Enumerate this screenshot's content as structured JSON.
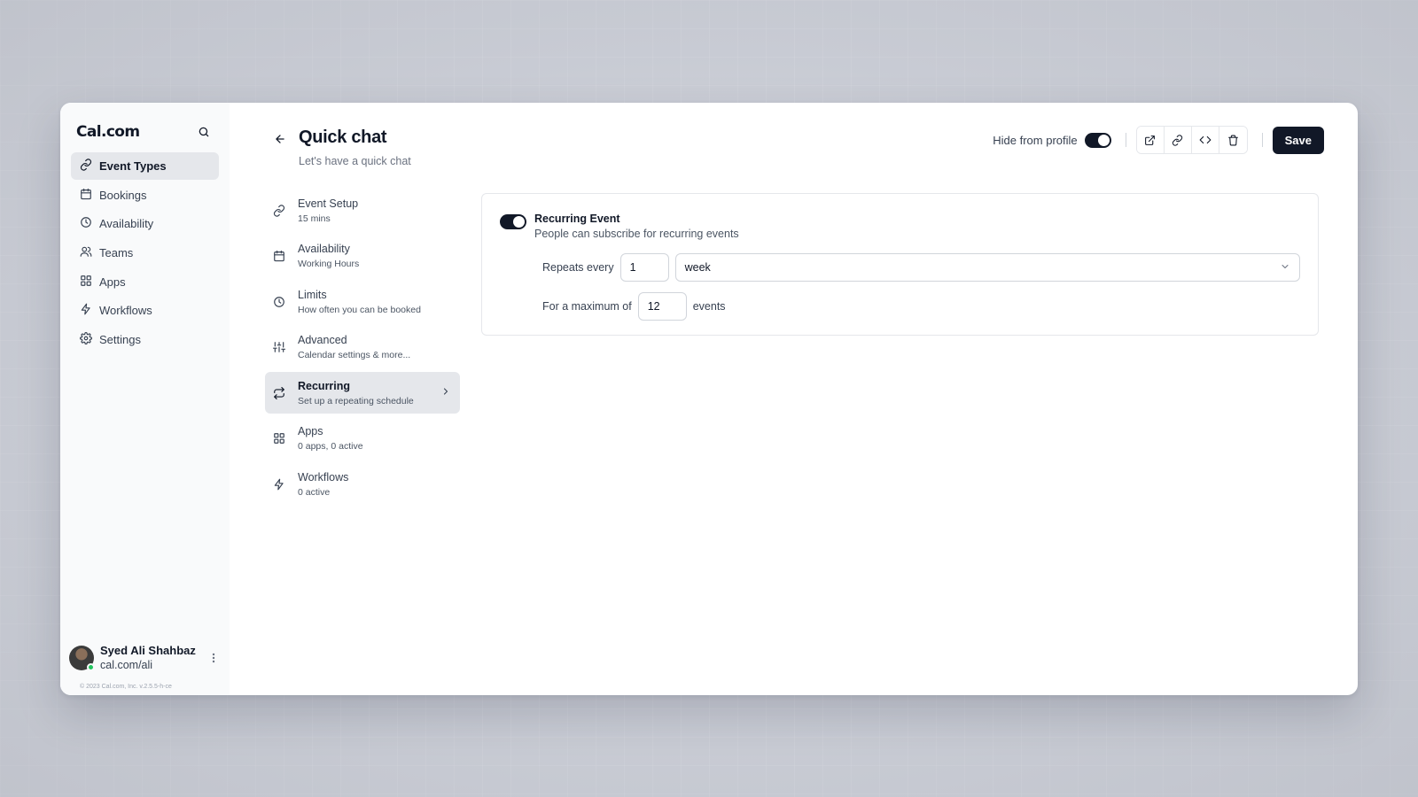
{
  "brand": "Cal.com",
  "sidebar": {
    "items": [
      {
        "label": "Event Types",
        "icon": "link-icon",
        "active": true
      },
      {
        "label": "Bookings",
        "icon": "calendar-icon"
      },
      {
        "label": "Availability",
        "icon": "clock-icon"
      },
      {
        "label": "Teams",
        "icon": "users-icon"
      },
      {
        "label": "Apps",
        "icon": "grid-icon"
      },
      {
        "label": "Workflows",
        "icon": "zap-icon"
      },
      {
        "label": "Settings",
        "icon": "gear-icon"
      }
    ]
  },
  "user": {
    "name": "Syed Ali Shahbaz",
    "handle": "cal.com/ali",
    "status_color": "#22c55e"
  },
  "copyright": "© 2023 Cal.com, Inc. v.2.5.5-h-ce",
  "header": {
    "title": "Quick chat",
    "subtitle": "Let's have a quick chat",
    "hide_from_profile_label": "Hide from profile",
    "hide_from_profile_on": true,
    "save_label": "Save"
  },
  "tabs": [
    {
      "title": "Event Setup",
      "desc": "15 mins",
      "icon": "link-icon"
    },
    {
      "title": "Availability",
      "desc": "Working Hours",
      "icon": "calendar-icon"
    },
    {
      "title": "Limits",
      "desc": "How often you can be booked",
      "icon": "clock-icon"
    },
    {
      "title": "Advanced",
      "desc": "Calendar settings & more...",
      "icon": "sliders-icon"
    },
    {
      "title": "Recurring",
      "desc": "Set up a repeating schedule",
      "icon": "repeat-icon",
      "active": true
    },
    {
      "title": "Apps",
      "desc": "0 apps, 0 active",
      "icon": "grid-icon"
    },
    {
      "title": "Workflows",
      "desc": "0 active",
      "icon": "zap-icon"
    }
  ],
  "recurring": {
    "enabled": true,
    "title": "Recurring Event",
    "desc": "People can subscribe for recurring events",
    "repeats_label": "Repeats every",
    "repeats_value": "1",
    "frequency": "week",
    "max_label": "For a maximum of",
    "max_value": "12",
    "events_label": "events"
  },
  "colors": {
    "accent": "#111827",
    "sidebar_bg": "#f9fafb",
    "active_bg": "#e5e7eb"
  }
}
